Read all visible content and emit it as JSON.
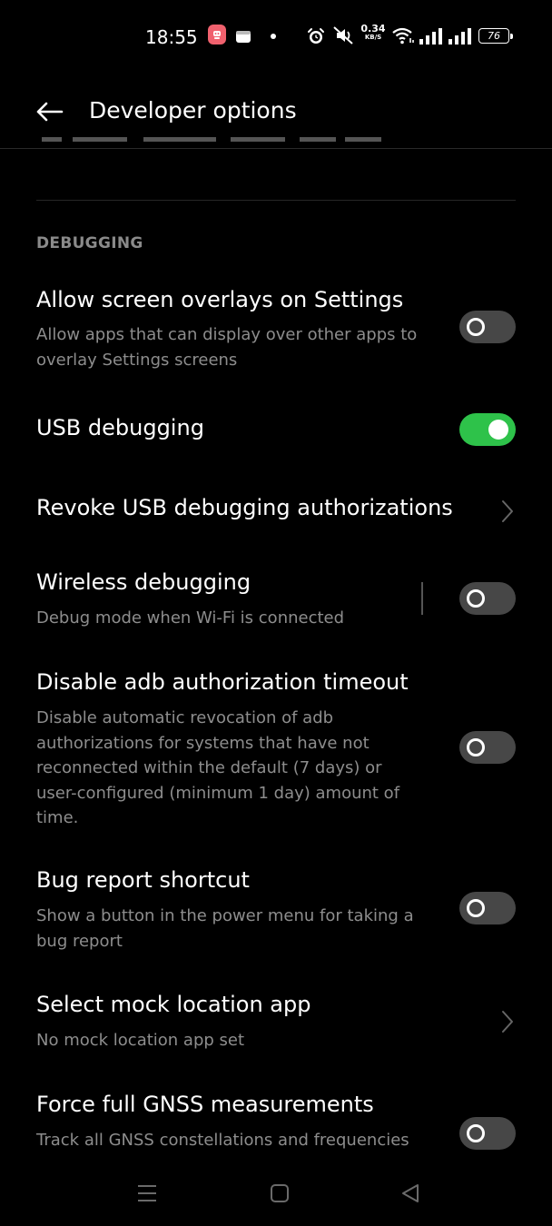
{
  "status_bar": {
    "time": "18:55",
    "net_speed_value": "0.34",
    "net_speed_unit": "KB/S",
    "battery_level": "76",
    "icons": [
      "app-notification-icon",
      "app-notification-icon",
      "dot-icon",
      "alarm-icon",
      "mute-icon",
      "wifi-icon",
      "signal-icon",
      "signal-icon",
      "battery-icon"
    ]
  },
  "app_bar": {
    "title": "Developer options",
    "back_icon": "arrow-left-icon"
  },
  "section": {
    "header": "DEBUGGING"
  },
  "settings": [
    {
      "title": "Allow screen overlays on Settings",
      "subtitle": "Allow apps that can display over other apps to overlay Settings screens",
      "control": "toggle",
      "on": false
    },
    {
      "title": "USB debugging",
      "subtitle": "",
      "control": "toggle",
      "on": true
    },
    {
      "title": "Revoke USB debugging authorizations",
      "subtitle": "",
      "control": "chevron"
    },
    {
      "title": "Wireless debugging",
      "subtitle": "Debug mode when Wi-Fi is connected",
      "control": "toggle",
      "on": false
    },
    {
      "title": "Disable adb authorization timeout",
      "subtitle": "Disable automatic revocation of adb authorizations for systems that have not reconnected within the default (7 days) or user-configured (minimum 1 day) amount of time.",
      "control": "toggle",
      "on": false
    },
    {
      "title": "Bug report shortcut",
      "subtitle": "Show a button in the power menu for taking a bug report",
      "control": "toggle",
      "on": false
    },
    {
      "title": "Select mock location app",
      "subtitle": "No mock location app set",
      "control": "chevron"
    },
    {
      "title": "Force full GNSS measurements",
      "subtitle": "Track all GNSS constellations and frequencies",
      "control": "toggle",
      "on": false
    }
  ],
  "nav_bar": {
    "icons": [
      "menu-icon",
      "home-icon",
      "back-triangle-icon"
    ]
  },
  "colors": {
    "background": "#000000",
    "toggle_on": "#2ec24a",
    "toggle_off": "#474747",
    "secondary_text": "#8d8d8d",
    "section_header": "#8a8a8a"
  }
}
